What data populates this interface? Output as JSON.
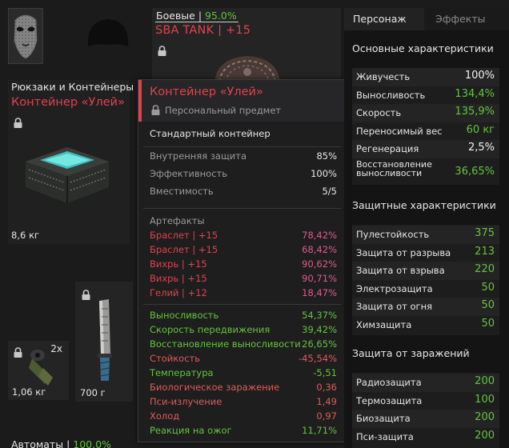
{
  "colors": {
    "accent_red": "#e0424d",
    "stat_green": "#64c43b",
    "artifact_pink": "#e05a8a",
    "negative_red": "#e05a5a",
    "grey": "#9a9a9a"
  },
  "inventory": {
    "mask": {
      "icon": "mask-icon"
    },
    "helmet": {
      "icon": "helmet-icon"
    },
    "armor": {
      "category": "Боевые",
      "sep": " | ",
      "percent": "95.0%",
      "name": "SBA TANK | +15",
      "icon": "armor-icon"
    },
    "backpack": {
      "category": "Рюкзаки и Контейнеры",
      "name": "Контейнер «Улей»",
      "weight": "8,6 кг",
      "icon": "container-icon"
    },
    "grenade": {
      "count": "2x",
      "weight": "1,06 кг",
      "icon": "grenade-icon"
    },
    "knife": {
      "weight": "700 г",
      "icon": "knife-icon"
    },
    "weapons": {
      "category": "Автоматы",
      "sep": " | ",
      "percent": "100.0%"
    }
  },
  "tooltip": {
    "title": "Контейнер «Улей»",
    "subtitle": "Персональный предмет",
    "description": "Стандартный контейнер",
    "props": [
      {
        "label": "Внутренняя защита",
        "value": "85%"
      },
      {
        "label": "Эффективность",
        "value": "100%"
      },
      {
        "label": "Вместимость",
        "value": "5/5"
      }
    ],
    "artifacts_title": "Артефакты",
    "artifacts": [
      {
        "name": "Браслет | +15",
        "value": "78,42%"
      },
      {
        "name": "Браслет | +15",
        "value": "68,42%"
      },
      {
        "name": "Вихрь | +15",
        "value": "90,62%"
      },
      {
        "name": "Вихрь | +15",
        "value": "90,71%"
      },
      {
        "name": "Гелий | +12",
        "value": "18,47%"
      }
    ],
    "effects": [
      {
        "label": "Выносливость",
        "value": "54,37%",
        "tone": "pos"
      },
      {
        "label": "Скорость передвижения",
        "value": "39,42%",
        "tone": "pos"
      },
      {
        "label": "Восстановление выносливости",
        "value": "26,65%",
        "tone": "pos"
      },
      {
        "label": "Стойкость",
        "value": "-45,54%",
        "tone": "neg"
      },
      {
        "label": "Температура",
        "value": "-5,51",
        "tone": "pos"
      },
      {
        "label": "Биологическое заражение",
        "value": "0,36",
        "tone": "neg"
      },
      {
        "label": "Пси-излучение",
        "value": "1,49",
        "tone": "neg"
      },
      {
        "label": "Холод",
        "value": "0,97",
        "tone": "neg"
      },
      {
        "label": "Реакция на ожог",
        "value": "11,71%",
        "tone": "pos"
      }
    ]
  },
  "panel": {
    "tabs": {
      "character": "Персонаж",
      "effects": "Эффекты"
    },
    "main_title": "Основные характеристики",
    "main_stats": [
      {
        "label": "Живучесть",
        "value": "100%",
        "tone": "white"
      },
      {
        "label": "Выносливость",
        "value": "134,4%",
        "tone": "green"
      },
      {
        "label": "Скорость",
        "value": "135,9%",
        "tone": "green"
      },
      {
        "label": "Переносимый вес",
        "value": "60 кг",
        "tone": "green"
      },
      {
        "label": "Регенерация",
        "value": "2,5%",
        "tone": "white"
      },
      {
        "label": "Восстановление выносливости",
        "value": "36,65%",
        "tone": "green",
        "two_line": true
      }
    ],
    "protect_title": "Защитные характеристики",
    "protect_stats": [
      {
        "label": "Пулестойкость",
        "value": "375"
      },
      {
        "label": "Защита от разрыва",
        "value": "213"
      },
      {
        "label": "Защита от взрыва",
        "value": "220"
      },
      {
        "label": "Электрозащита",
        "value": "50"
      },
      {
        "label": "Защита от огня",
        "value": "50"
      },
      {
        "label": "Химзащита",
        "value": "50"
      }
    ],
    "contam_title": "Защита от заражений",
    "contam_stats": [
      {
        "label": "Радиозащита",
        "value": "200"
      },
      {
        "label": "Термозащита",
        "value": "100"
      },
      {
        "label": "Биозащита",
        "value": "200"
      },
      {
        "label": "Пси-защита",
        "value": "200"
      }
    ]
  }
}
